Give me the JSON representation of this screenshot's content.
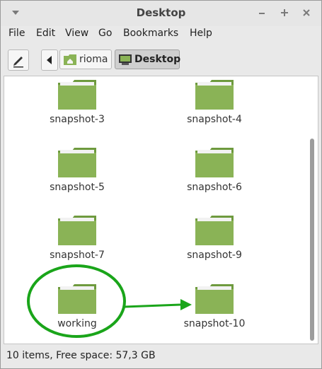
{
  "window": {
    "title": "Desktop"
  },
  "menubar": [
    "File",
    "Edit",
    "View",
    "Go",
    "Bookmarks",
    "Help"
  ],
  "toolbar": {
    "edit_icon": "pencil-icon",
    "back_icon": "left-arrow-icon",
    "breadcrumb": [
      {
        "label": "rioma",
        "icon": "home-folder-icon"
      },
      {
        "label": "Desktop",
        "icon": "desktop-icon"
      }
    ]
  },
  "files": [
    {
      "name": "snapshot-3",
      "icon": "folder-icon"
    },
    {
      "name": "snapshot-4",
      "icon": "folder-icon"
    },
    {
      "name": "snapshot-5",
      "icon": "folder-icon"
    },
    {
      "name": "snapshot-6",
      "icon": "folder-icon"
    },
    {
      "name": "snapshot-7",
      "icon": "folder-icon"
    },
    {
      "name": "snapshot-9",
      "icon": "folder-icon"
    },
    {
      "name": "working",
      "icon": "folder-icon"
    },
    {
      "name": "snapshot-10",
      "icon": "folder-icon"
    }
  ],
  "annotation": {
    "color": "#1aa51a"
  },
  "colors": {
    "folder": "#8ab356",
    "folder_dark": "#6e9a3e"
  },
  "status": {
    "text": "10 items, Free space: 57,3 GB"
  }
}
